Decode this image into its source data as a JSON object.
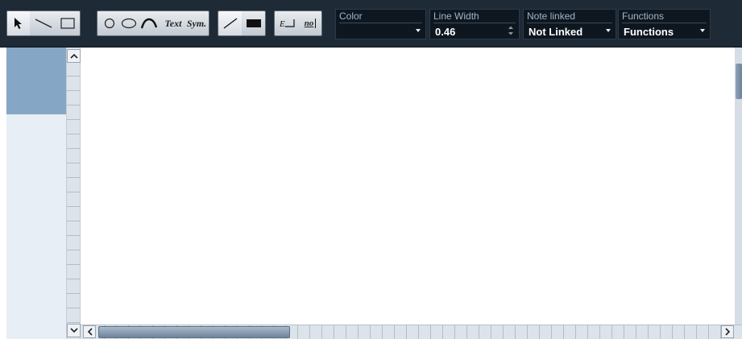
{
  "toolbar": {
    "tools": [
      {
        "name": "pointer-tool",
        "icon": "arrow-pointer-icon",
        "active": true
      },
      {
        "name": "line-tool",
        "icon": "diagonal-line-icon"
      },
      {
        "name": "rectangle-tool",
        "icon": "rectangle-outline-icon"
      },
      {
        "name": "circle-tool",
        "icon": "circle-icon"
      },
      {
        "name": "ellipse-tool",
        "icon": "ellipse-icon"
      },
      {
        "name": "arc-tool",
        "icon": "arc-icon"
      },
      {
        "name": "text-tool",
        "label": "Text"
      },
      {
        "name": "symbol-tool",
        "label": "Sym."
      },
      {
        "name": "line-style",
        "icon": "slash-line-icon"
      },
      {
        "name": "fill-style",
        "icon": "filled-rectangle-icon"
      },
      {
        "name": "note-frame",
        "icon": "text-frame-icon",
        "label": "E"
      },
      {
        "name": "no-frame",
        "label": "no"
      }
    ],
    "fields": {
      "color": {
        "label": "Color",
        "value": ""
      },
      "line_width": {
        "label": "Line Width",
        "value": "0.46"
      },
      "note_linked": {
        "label": "Note linked",
        "value": "Not Linked"
      },
      "functions": {
        "label": "Functions",
        "value": "Functions"
      }
    }
  },
  "colors": {
    "toolbar_bg": "#1e2a36",
    "field_bg": "#0e1720",
    "selection": "#86a6c6",
    "panel": "#e8eef5"
  },
  "scroll": {
    "up_icon": "chevron-up-icon",
    "down_icon": "chevron-down-icon",
    "left_icon": "chevron-left-icon",
    "right_icon": "chevron-right-icon"
  }
}
